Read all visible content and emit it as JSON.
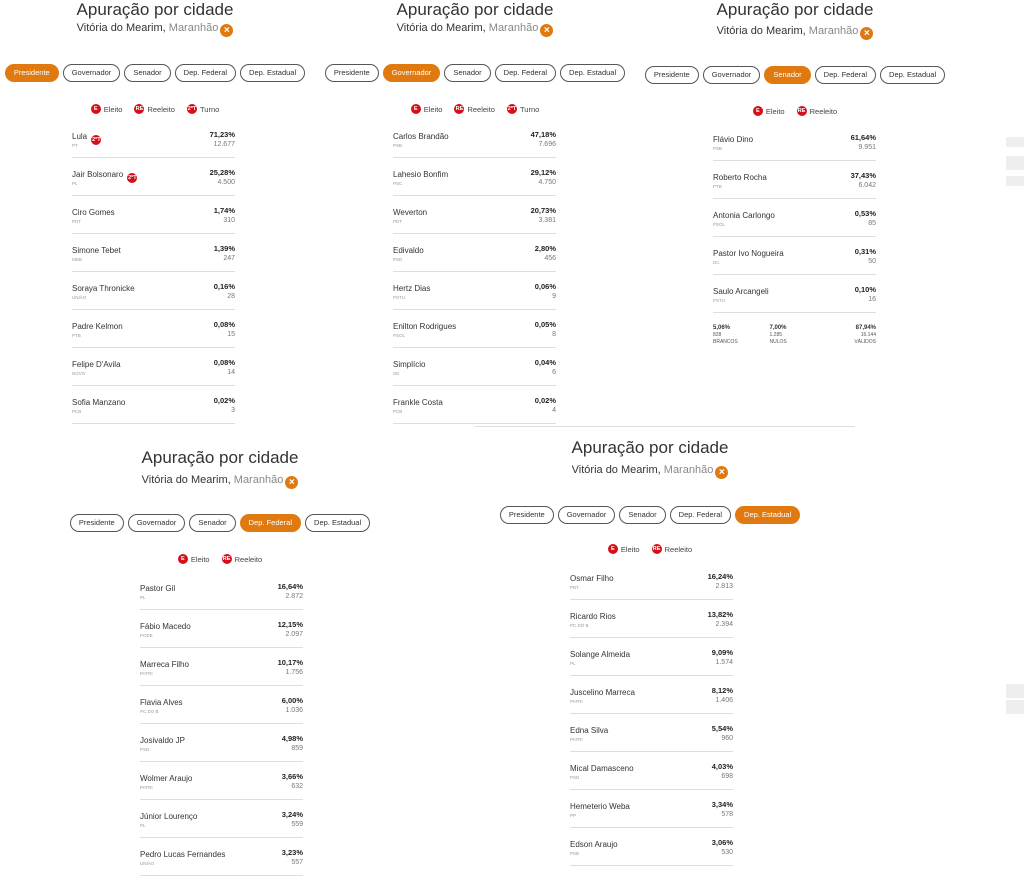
{
  "panels": [
    {
      "title": "Apuração por cidade",
      "city": "Vitória do Mearim,",
      "state": "Maranhão",
      "tabs": [
        "Presidente",
        "Governador",
        "Senador",
        "Dep. Federal",
        "Dep. Estadual"
      ],
      "active": 0,
      "legend": {
        "eleito": "Eleito",
        "reeleito": "Reeleito",
        "turno": "Turno"
      },
      "rows": [
        {
          "name": "Lula",
          "party": "PT",
          "pct": "71,23%",
          "votes": "12.677",
          "badge": "2ºT"
        },
        {
          "name": "Jair Bolsonaro",
          "party": "PL",
          "pct": "25,28%",
          "votes": "4.500",
          "badge": "2ºT"
        },
        {
          "name": "Ciro Gomes",
          "party": "PDT",
          "pct": "1,74%",
          "votes": "310"
        },
        {
          "name": "Simone Tebet",
          "party": "MDB",
          "pct": "1,39%",
          "votes": "247"
        },
        {
          "name": "Soraya Thronicke",
          "party": "UNIÃO",
          "pct": "0,16%",
          "votes": "28"
        },
        {
          "name": "Padre Kelmon",
          "party": "PTB",
          "pct": "0,08%",
          "votes": "15"
        },
        {
          "name": "Felipe D'Avila",
          "party": "NOVO",
          "pct": "0,08%",
          "votes": "14"
        },
        {
          "name": "Sofia Manzano",
          "party": "PCB",
          "pct": "0,02%",
          "votes": "3"
        }
      ]
    },
    {
      "title": "Apuração por cidade",
      "city": "Vitória do Mearim,",
      "state": "Maranhão",
      "tabs": [
        "Presidente",
        "Governador",
        "Senador",
        "Dep. Federal",
        "Dep. Estadual"
      ],
      "active": 1,
      "legend": {
        "eleito": "Eleito",
        "reeleito": "Reeleito",
        "turno": "Turno"
      },
      "rows": [
        {
          "name": "Carlos Brandão",
          "party": "PSB",
          "pct": "47,18%",
          "votes": "7.696"
        },
        {
          "name": "Lahesio Bonfim",
          "party": "PSC",
          "pct": "29,12%",
          "votes": "4.750"
        },
        {
          "name": "Weverton",
          "party": "PDT",
          "pct": "20,73%",
          "votes": "3.381"
        },
        {
          "name": "Edivaldo",
          "party": "PSD",
          "pct": "2,80%",
          "votes": "456"
        },
        {
          "name": "Hertz Dias",
          "party": "PSTU",
          "pct": "0,06%",
          "votes": "9"
        },
        {
          "name": "Enilton Rodrigues",
          "party": "PSOL",
          "pct": "0,05%",
          "votes": "8"
        },
        {
          "name": "Simplício",
          "party": "SD",
          "pct": "0,04%",
          "votes": "6"
        },
        {
          "name": "Frankle Costa",
          "party": "PCB",
          "pct": "0,02%",
          "votes": "4"
        }
      ]
    },
    {
      "title": "Apuração por cidade",
      "city": "Vitória do Mearim,",
      "state": "Maranhão",
      "tabs": [
        "Presidente",
        "Governador",
        "Senador",
        "Dep. Federal",
        "Dep. Estadual"
      ],
      "active": 2,
      "legend": {
        "eleito": "Eleito",
        "reeleito": "Reeleito"
      },
      "rows": [
        {
          "name": "Flávio Dino",
          "party": "PSB",
          "pct": "61,64%",
          "votes": "9.951"
        },
        {
          "name": "Roberto Rocha",
          "party": "PTB",
          "pct": "37,43%",
          "votes": "6.042"
        },
        {
          "name": "Antonia Carlongo",
          "party": "PSOL",
          "pct": "0,53%",
          "votes": "85"
        },
        {
          "name": "Pastor Ivo Nogueira",
          "party": "DC",
          "pct": "0,31%",
          "votes": "50"
        },
        {
          "name": "Saulo Arcangeli",
          "party": "PSTU",
          "pct": "0,10%",
          "votes": "16"
        }
      ],
      "summary": [
        {
          "pct": "5,06%",
          "count": "828",
          "label": "BRANCOS"
        },
        {
          "pct": "7,00%",
          "count": "1.285",
          "label": "NULOS"
        },
        {
          "pct": "87,94%",
          "count": "16.144",
          "label": "VÁLIDOS"
        }
      ]
    },
    {
      "title": "Apuração por cidade",
      "city": "Vitória do Mearim,",
      "state": "Maranhão",
      "tabs": [
        "Presidente",
        "Governador",
        "Senador",
        "Dep. Federal",
        "Dep. Estadual"
      ],
      "active": 3,
      "legend": {
        "eleito": "Eleito",
        "reeleito": "Reeleito"
      },
      "rows": [
        {
          "name": "Pastor Gil",
          "party": "PL",
          "pct": "16,64%",
          "votes": "2.872"
        },
        {
          "name": "Fábio Macedo",
          "party": "PODE",
          "pct": "12,15%",
          "votes": "2.097"
        },
        {
          "name": "Marreca Filho",
          "party": "PATRI",
          "pct": "10,17%",
          "votes": "1.756"
        },
        {
          "name": "Flavia Alves",
          "party": "PC DO B",
          "pct": "6,00%",
          "votes": "1.036"
        },
        {
          "name": "Josivaldo JP",
          "party": "PSD",
          "pct": "4,98%",
          "votes": "859"
        },
        {
          "name": "Wolmer Araujo",
          "party": "PATRI",
          "pct": "3,66%",
          "votes": "632"
        },
        {
          "name": "Júnior Lourenço",
          "party": "PL",
          "pct": "3,24%",
          "votes": "559"
        },
        {
          "name": "Pedro Lucas Fernandes",
          "party": "UNIÃO",
          "pct": "3,23%",
          "votes": "557"
        }
      ]
    },
    {
      "title": "Apuração por cidade",
      "city": "Vitória do Mearim,",
      "state": "Maranhão",
      "tabs": [
        "Presidente",
        "Governador",
        "Senador",
        "Dep. Federal",
        "Dep. Estadual"
      ],
      "active": 4,
      "legend": {
        "eleito": "Eleito",
        "reeleito": "Reeleito"
      },
      "rows": [
        {
          "name": "Osmar Filho",
          "party": "PDT",
          "pct": "16,24%",
          "votes": "2.813"
        },
        {
          "name": "Ricardo Rios",
          "party": "PC DO B",
          "pct": "13,82%",
          "votes": "2.394"
        },
        {
          "name": "Solange Almeida",
          "party": "PL",
          "pct": "9,09%",
          "votes": "1.574"
        },
        {
          "name": "Juscelino Marreca",
          "party": "PATRI",
          "pct": "8,12%",
          "votes": "1.406"
        },
        {
          "name": "Edna Silva",
          "party": "PATRI",
          "pct": "5,54%",
          "votes": "960"
        },
        {
          "name": "Mical Damasceno",
          "party": "PSD",
          "pct": "4,03%",
          "votes": "698"
        },
        {
          "name": "Hemeterio Weba",
          "party": "PP",
          "pct": "3,34%",
          "votes": "578"
        },
        {
          "name": "Edson Araujo",
          "party": "PSB",
          "pct": "3,06%",
          "votes": "530"
        }
      ]
    }
  ],
  "colors": {
    "accent": "#e07a10",
    "badge": "#d6101a"
  }
}
